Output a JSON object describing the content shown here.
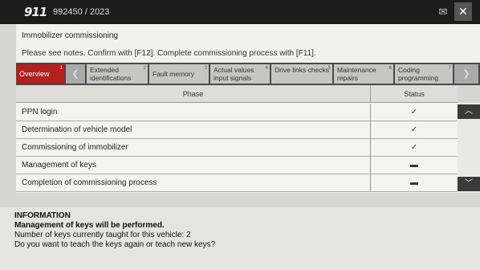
{
  "header": {
    "logo": "911",
    "vehicle_id": "992450 / 2023",
    "mail_icon": "mail-check-icon",
    "close_label": "✕"
  },
  "panel": {
    "title": "Immobilizer commissioning",
    "notes": "Please see notes. Confirm with [F12]. Complete commissioning process with [F11]."
  },
  "tabs": [
    {
      "label": "Overview",
      "num": "1",
      "active": true
    },
    {
      "label": "Extended identifications",
      "num": "2"
    },
    {
      "label": "Fault memory",
      "num": "3"
    },
    {
      "label": "Actual values input signals",
      "num": "4"
    },
    {
      "label": "Drive links checks",
      "num": "5"
    },
    {
      "label": "Maintenance repairs",
      "num": "6"
    },
    {
      "label": "Coding programming",
      "num": "7"
    }
  ],
  "table": {
    "header_phase": "Phase",
    "header_status": "Status",
    "rows": [
      {
        "phase": "PPN login",
        "status": "✓"
      },
      {
        "phase": "Determination of vehicle model",
        "status": "✓"
      },
      {
        "phase": "Commissioning of immobilizer",
        "status": "✓"
      },
      {
        "phase": "Management of keys",
        "status": "▬"
      },
      {
        "phase": "Completion of commissioning process",
        "status": "▬"
      }
    ]
  },
  "info": {
    "heading": "INFORMATION",
    "bold_line": "Management of keys will be performed.",
    "line1": "Number of keys currently taught for this vehicle: 2",
    "line2": "Do you want to teach the keys again or teach new keys?"
  },
  "colors": {
    "active_tab": "#b21f1f",
    "topbar": "#1c1c1c"
  }
}
